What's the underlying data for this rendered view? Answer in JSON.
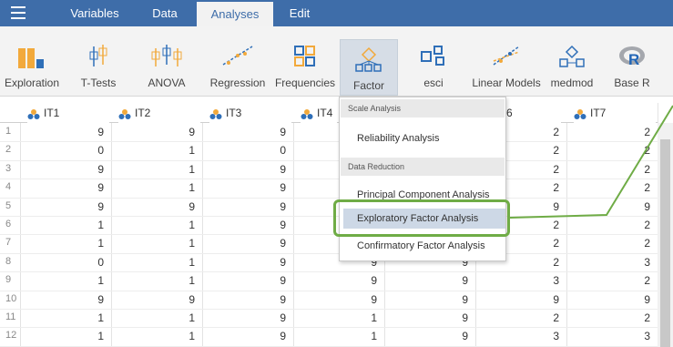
{
  "menubar": {
    "tabs": [
      {
        "label": "Variables"
      },
      {
        "label": "Data"
      },
      {
        "label": "Analyses"
      },
      {
        "label": "Edit"
      }
    ]
  },
  "ribbon": {
    "buttons": [
      {
        "label": "Exploration",
        "icon": "exploration-bars-icon"
      },
      {
        "label": "T-Tests",
        "icon": "ttests-icon"
      },
      {
        "label": "ANOVA",
        "icon": "anova-icon"
      },
      {
        "label": "Regression",
        "icon": "regression-icon"
      },
      {
        "label": "Frequencies",
        "icon": "frequencies-icon"
      },
      {
        "label": "Factor",
        "icon": "factor-icon"
      },
      {
        "label": "esci",
        "icon": "esci-icon"
      },
      {
        "label": "Linear Models",
        "icon": "linear-models-icon"
      },
      {
        "label": "medmod",
        "icon": "medmod-icon"
      },
      {
        "label": "Base R",
        "icon": "r-logo-icon"
      }
    ]
  },
  "grid": {
    "columns": [
      "IT1",
      "IT2",
      "IT3",
      "IT4",
      "",
      "6",
      "IT7"
    ],
    "row_numbers": [
      "1",
      "2",
      "3",
      "4",
      "5",
      "6",
      "7",
      "8",
      "9",
      "10",
      "11",
      "12"
    ],
    "rows": [
      [
        "9",
        "9",
        "9",
        "",
        "",
        "2",
        "2"
      ],
      [
        "0",
        "1",
        "0",
        "",
        "",
        "2",
        "2"
      ],
      [
        "9",
        "1",
        "9",
        "",
        "",
        "2",
        "2"
      ],
      [
        "9",
        "1",
        "9",
        "",
        "",
        "2",
        "2"
      ],
      [
        "9",
        "9",
        "9",
        "",
        "",
        "9",
        "9"
      ],
      [
        "1",
        "1",
        "9",
        "",
        "",
        "2",
        "2"
      ],
      [
        "1",
        "1",
        "9",
        "",
        "",
        "2",
        "2"
      ],
      [
        "0",
        "1",
        "9",
        "9",
        "9",
        "2",
        "3"
      ],
      [
        "1",
        "1",
        "9",
        "9",
        "9",
        "3",
        "2"
      ],
      [
        "9",
        "9",
        "9",
        "9",
        "9",
        "9",
        "9"
      ],
      [
        "1",
        "1",
        "9",
        "1",
        "9",
        "2",
        "2"
      ],
      [
        "1",
        "1",
        "9",
        "1",
        "9",
        "3",
        "3"
      ]
    ]
  },
  "dropdown": {
    "sections": [
      {
        "title": "Scale Analysis",
        "items": [
          "Reliability Analysis"
        ]
      },
      {
        "title": "Data Reduction",
        "items": [
          "Principal Component Analysis",
          "Exploratory Factor Analysis",
          "Confirmatory Factor Analysis"
        ]
      }
    ],
    "highlighted": "Exploratory Factor Analysis"
  },
  "colors": {
    "menubar": "#3e6da9",
    "icon_blue": "#2f6fb8",
    "icon_orange": "#f2a93b",
    "callout_green": "#6fac46"
  }
}
